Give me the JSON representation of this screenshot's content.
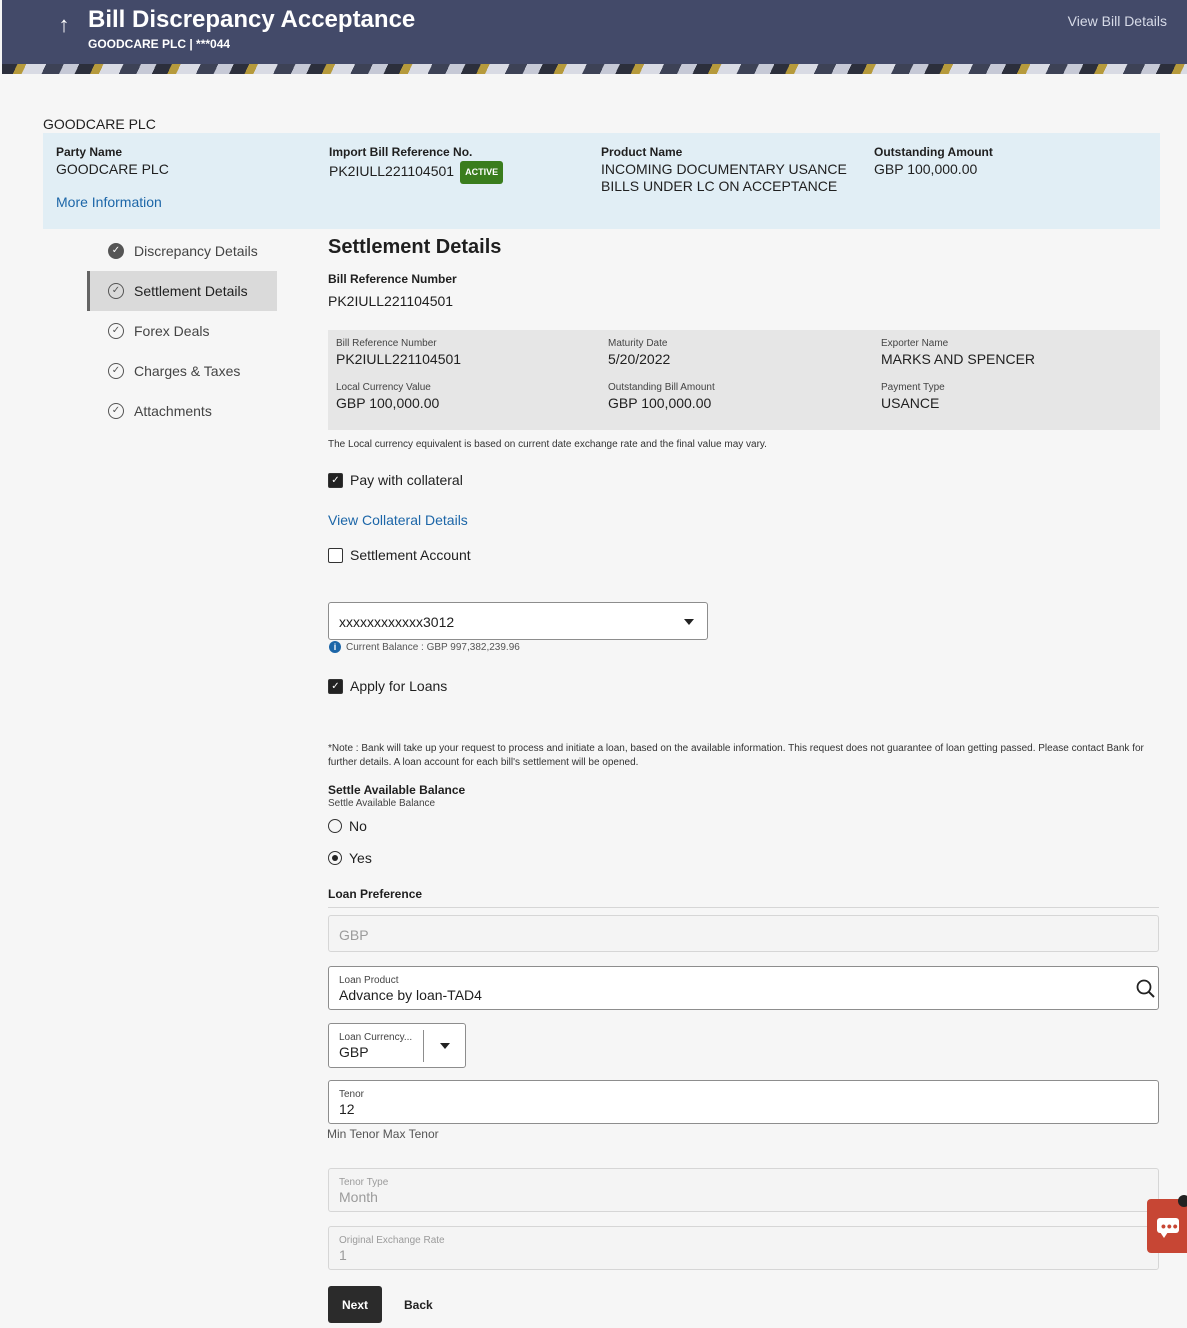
{
  "header": {
    "back_icon": "arrow-up-icon",
    "title": "Bill Discrepancy Acceptance",
    "subtitle": "GOODCARE PLC | ***044",
    "view_bill_details": "View Bill Details"
  },
  "company_name": "GOODCARE PLC",
  "summary": {
    "party_name_label": "Party Name",
    "party_name": "GOODCARE PLC",
    "import_ref_label": "Import Bill Reference No.",
    "import_ref": "PK2IULL221104501",
    "status_badge": "ACTIVE",
    "product_name_label": "Product Name",
    "product_name": "INCOMING DOCUMENTARY USANCE BILLS UNDER LC ON ACCEPTANCE",
    "outstanding_label": "Outstanding Amount",
    "outstanding": "GBP 100,000.00",
    "more_info": "More Information"
  },
  "steps": [
    {
      "label": "Discrepancy Details",
      "state": "completed"
    },
    {
      "label": "Settlement Details",
      "state": "active"
    },
    {
      "label": "Forex Deals",
      "state": "pending"
    },
    {
      "label": "Charges & Taxes",
      "state": "pending"
    },
    {
      "label": "Attachments",
      "state": "pending"
    }
  ],
  "settlement": {
    "title": "Settlement Details",
    "bill_ref_label": "Bill Reference Number",
    "bill_ref": "PK2IULL221104501",
    "info": {
      "bill_ref_label": "Bill Reference Number",
      "bill_ref": "PK2IULL221104501",
      "maturity_label": "Maturity Date",
      "maturity": "5/20/2022",
      "exporter_label": "Exporter Name",
      "exporter": "MARKS AND SPENCER",
      "local_value_label": "Local Currency Value",
      "local_value": "GBP 100,000.00",
      "outstanding_label": "Outstanding Bill Amount",
      "outstanding": "GBP 100,000.00",
      "payment_type_label": "Payment Type",
      "payment_type": "USANCE"
    },
    "exchange_note": "The Local currency equivalent is based on current date exchange rate and the final value may vary.",
    "pay_with_collateral": {
      "label": "Pay with collateral",
      "checked": true
    },
    "view_collateral": "View Collateral Details",
    "settlement_account": {
      "label": "Settlement Account",
      "checked": false
    },
    "account_select": "xxxxxxxxxxxx3012",
    "current_balance": "Current Balance : GBP 997,382,239.96",
    "apply_loans": {
      "label": "Apply for Loans",
      "checked": true
    },
    "loan_note": "*Note : Bank will take up your request to process and initiate a loan, based on the available information. This request does not guarantee of loan getting passed. Please contact Bank for further details. A loan account for each bill's settlement will be opened.",
    "settle_balance_title": "Settle Available Balance",
    "settle_balance_sub": "Settle Available Balance",
    "radio_no": "No",
    "radio_yes": "Yes",
    "selected_radio": "Yes",
    "loan_pref_title": "Loan Preference",
    "loan_pref_currency": "GBP",
    "loan_product_label": "Loan Product",
    "loan_product": "Advance by loan-TAD4",
    "loan_currency_label": "Loan Currency...",
    "loan_currency": "GBP",
    "tenor_label": "Tenor",
    "tenor": "12",
    "tenor_hint": "Min Tenor Max Tenor",
    "tenor_type_label": "Tenor Type",
    "tenor_type": "Month",
    "exchange_rate_label": "Original Exchange Rate",
    "exchange_rate": "1"
  },
  "buttons": {
    "next": "Next",
    "back": "Back"
  },
  "colors": {
    "header_bg": "#434a69",
    "summary_bg": "#e1eef5",
    "link": "#1c66a8",
    "badge": "#3a7d1d",
    "chat": "#c74634"
  }
}
